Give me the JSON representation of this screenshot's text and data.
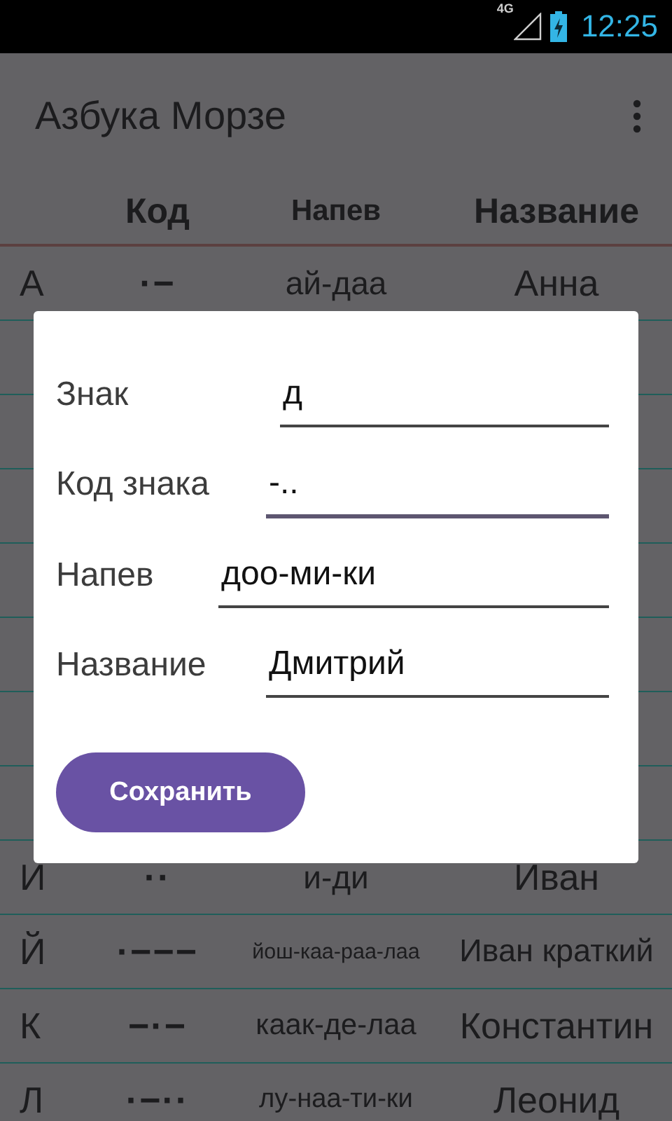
{
  "status_bar": {
    "network": "4G",
    "time": "12:25"
  },
  "app_bar": {
    "title": "Азбука Морзе"
  },
  "table": {
    "columns": [
      "Код",
      "Напев",
      "Название"
    ],
    "rows_above": [
      {
        "letter": "А",
        "code": "·−",
        "chant": "ай-даа",
        "name": "Анна"
      }
    ],
    "rows_below": [
      {
        "letter": "И",
        "code": "··",
        "chant": "и-ди",
        "name": "Иван"
      },
      {
        "letter": "Й",
        "code": "·−−−",
        "chant": "йош-каа-раа-лаа",
        "name": "Иван краткий"
      },
      {
        "letter": "К",
        "code": "−·−",
        "chant": "каак-де-лаа",
        "name": "Константин"
      },
      {
        "letter": "Л",
        "code": "·−··",
        "chant": "лу-наа-ти-ки",
        "name": "Леонид"
      }
    ]
  },
  "dialog": {
    "fields": [
      {
        "label": "Знак",
        "value": "д",
        "focused": false
      },
      {
        "label": "Код знака",
        "value": "-..",
        "focused": true
      },
      {
        "label": "Напев",
        "value": "доо-ми-ки",
        "focused": false
      },
      {
        "label": "Название",
        "value": "Дмитрий",
        "focused": false
      }
    ],
    "button": "Сохранить"
  }
}
